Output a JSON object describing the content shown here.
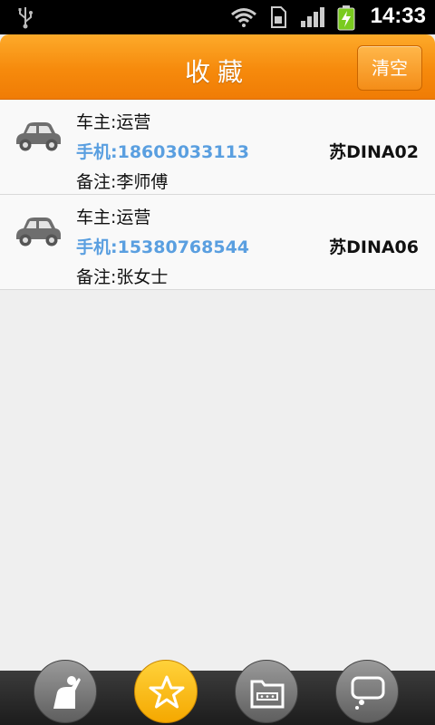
{
  "status_bar": {
    "time": "14:33",
    "icons": [
      "usb-icon",
      "wifi-icon",
      "sim-icon",
      "signal-icon",
      "battery-charging-icon"
    ]
  },
  "header": {
    "title": "收藏",
    "clear_label": "清空"
  },
  "favorites": [
    {
      "owner": "车主:运营",
      "phone": "手机:18603033113",
      "note": "备注:李师傅",
      "plate": "苏DINA02",
      "icon": "car-icon"
    },
    {
      "owner": "车主:运营",
      "phone": "手机:15380768544",
      "note": "备注:张女士",
      "plate": "苏DINA06",
      "icon": "car-icon"
    }
  ],
  "bottom_nav": {
    "items": [
      {
        "icon": "person-icon",
        "active": false
      },
      {
        "icon": "star-icon",
        "active": true
      },
      {
        "icon": "folder-icon",
        "active": false
      },
      {
        "icon": "chat-icon",
        "active": false
      }
    ]
  },
  "colors": {
    "header_orange": "#f68a0c",
    "phone_blue": "#5a9fe0",
    "active_nav": "#f5a800"
  }
}
